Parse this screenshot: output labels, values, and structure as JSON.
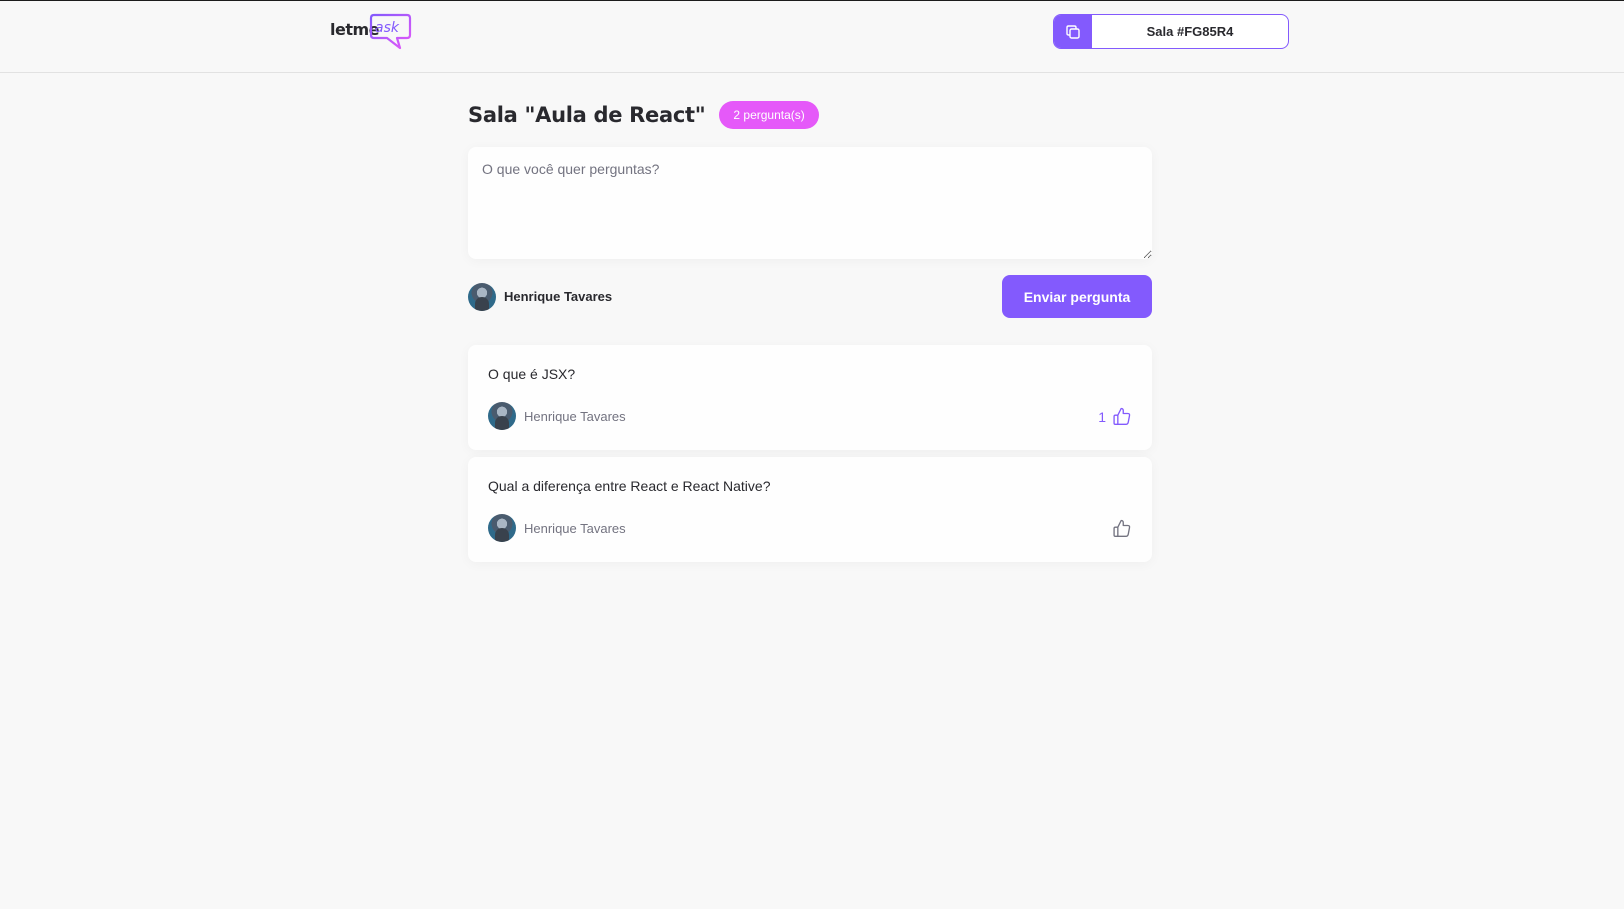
{
  "header": {
    "logo_main": "letme",
    "logo_accent": "ask",
    "room_code_label": "Sala #FG85R4"
  },
  "room": {
    "title": "Sala \"Aula de React\"",
    "question_count_badge": "2 pergunta(s)"
  },
  "form": {
    "placeholder": "O que você quer perguntas?",
    "value": "",
    "user_name": "Henrique Tavares",
    "submit_label": "Enviar pergunta"
  },
  "questions": [
    {
      "content": "O que é JSX?",
      "author": "Henrique Tavares",
      "like_count": "1",
      "liked": true
    },
    {
      "content": "Qual a diferença entre React e React Native?",
      "author": "Henrique Tavares",
      "like_count": "",
      "liked": false
    }
  ],
  "colors": {
    "primary": "#835afd",
    "pink": "#e559f9",
    "text": "#29292e",
    "muted": "#737380",
    "background": "#f8f8f8"
  },
  "icons": [
    "copy-icon",
    "like-icon"
  ]
}
